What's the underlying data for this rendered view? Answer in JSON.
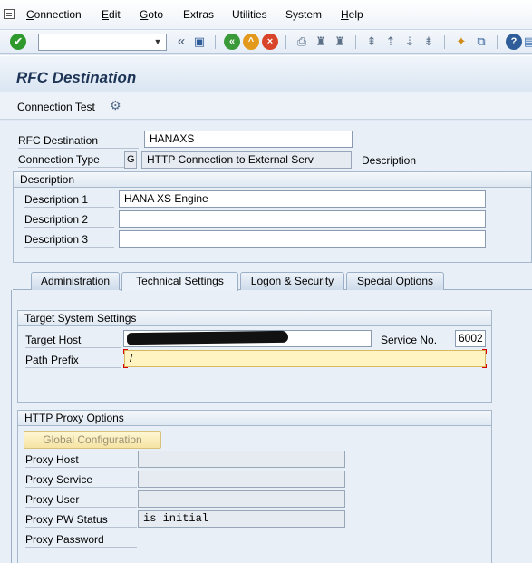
{
  "menu": {
    "items": [
      {
        "label": "Connection",
        "underline": "C",
        "rest": "onnection"
      },
      {
        "label": "Edit",
        "underline": "E",
        "rest": "dit"
      },
      {
        "label": "Goto",
        "underline": "G",
        "rest": "oto"
      },
      {
        "label": "Extras",
        "underline": "",
        "rest": "Extras"
      },
      {
        "label": "Utilities",
        "underline": "",
        "rest": "Utilities"
      },
      {
        "label": "System",
        "underline": "",
        "rest": "System"
      },
      {
        "label": "Help",
        "underline": "H",
        "rest": "elp"
      }
    ]
  },
  "toolbar": {
    "command_field_value": "",
    "icons": [
      "enter-icon",
      "save-icon",
      "back-icon",
      "exit-icon",
      "cancel-icon",
      "print-icon",
      "find-icon",
      "find-next-icon",
      "first-page-icon",
      "previous-page-icon",
      "next-page-icon",
      "last-page-icon",
      "create-session-icon",
      "shortcut-icon",
      "help-icon",
      "customize-layout-icon"
    ],
    "glyphs": {
      "enter": "✔",
      "back": "«",
      "save": "▣",
      "help": "?"
    }
  },
  "title": "RFC Destination",
  "app_toolbar": {
    "connection_test": "Connection Test",
    "icon": "⚙"
  },
  "header": {
    "rfc_destination_label": "RFC Destination",
    "rfc_destination_value": "HANAXS",
    "connection_type_label": "Connection Type",
    "connection_type_code": "G",
    "connection_type_text": "HTTP Connection to External Serv",
    "description_label": "Description"
  },
  "description_group": {
    "title": "Description",
    "rows": [
      {
        "label": "Description 1",
        "value": "HANA XS Engine"
      },
      {
        "label": "Description 2",
        "value": ""
      },
      {
        "label": "Description 3",
        "value": ""
      }
    ]
  },
  "tabs": [
    {
      "label": "Administration",
      "active": false
    },
    {
      "label": "Technical Settings",
      "active": true
    },
    {
      "label": "Logon & Security",
      "active": false
    },
    {
      "label": "Special Options",
      "active": false
    }
  ],
  "target_system": {
    "title": "Target System Settings",
    "target_host_label": "Target Host",
    "target_host_value": "",
    "service_no_label": "Service No.",
    "service_no_value": "6002",
    "path_prefix_label": "Path Prefix",
    "path_prefix_value": "/"
  },
  "proxy": {
    "title": "HTTP Proxy Options",
    "global_button": "Global Configuration",
    "rows": [
      {
        "label": "Proxy Host",
        "value": ""
      },
      {
        "label": "Proxy Service",
        "value": ""
      },
      {
        "label": "Proxy User",
        "value": ""
      },
      {
        "label": "Proxy PW Status",
        "value": "is initial"
      },
      {
        "label": "Proxy Password",
        "value": ""
      }
    ]
  },
  "colors": {
    "title": "#1d3456",
    "required_field": "#fff4c2",
    "enter_icon": "#2e9a2e"
  }
}
